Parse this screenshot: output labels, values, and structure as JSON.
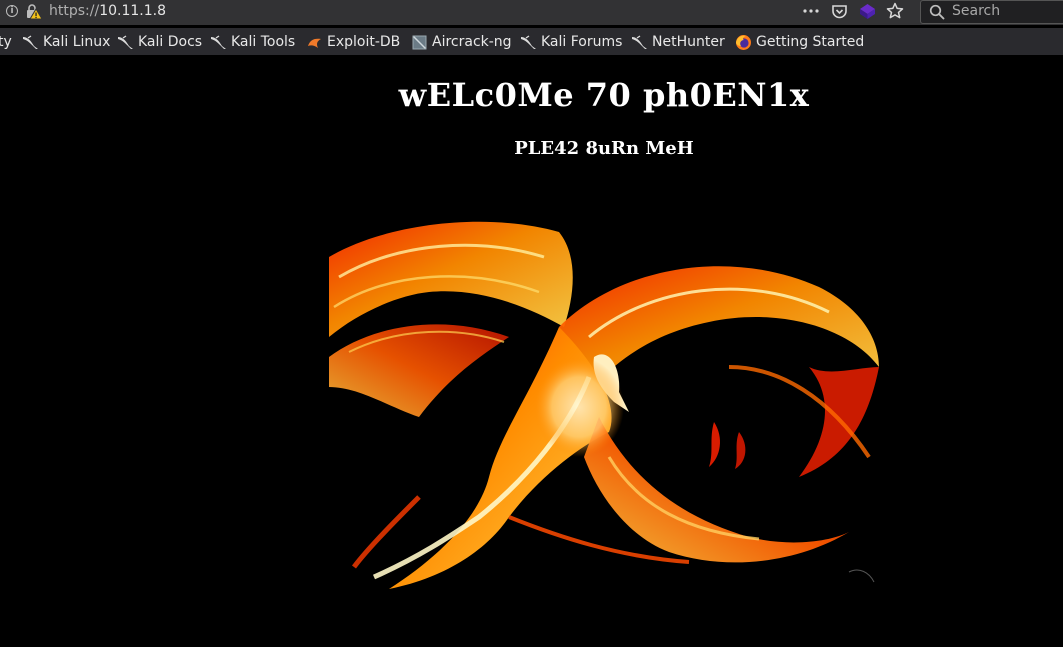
{
  "browser": {
    "url_scheme": "https://",
    "url_host": "10.11.1.8",
    "search_placeholder": "Search"
  },
  "bookmarks": [
    {
      "label": "ty",
      "icon": "truncated"
    },
    {
      "label": "Kali Linux",
      "icon": "kali-dragon-icon"
    },
    {
      "label": "Kali Docs",
      "icon": "kali-dragon-icon"
    },
    {
      "label": "Kali Tools",
      "icon": "kali-dragon-icon"
    },
    {
      "label": "Exploit-DB",
      "icon": "exploit-db-icon"
    },
    {
      "label": "Aircrack-ng",
      "icon": "aircrack-icon"
    },
    {
      "label": "Kali Forums",
      "icon": "kali-dragon-icon"
    },
    {
      "label": "NetHunter",
      "icon": "kali-dragon-icon"
    },
    {
      "label": "Getting Started",
      "icon": "firefox-icon"
    }
  ],
  "page": {
    "title": "wELc0Me 70 ph0EN1x",
    "subtitle": "PLE42 8uRn MeH",
    "image": "phoenix"
  },
  "colors": {
    "page_background": "#000000",
    "toolbar": "#323234",
    "text": "#ffffff"
  }
}
